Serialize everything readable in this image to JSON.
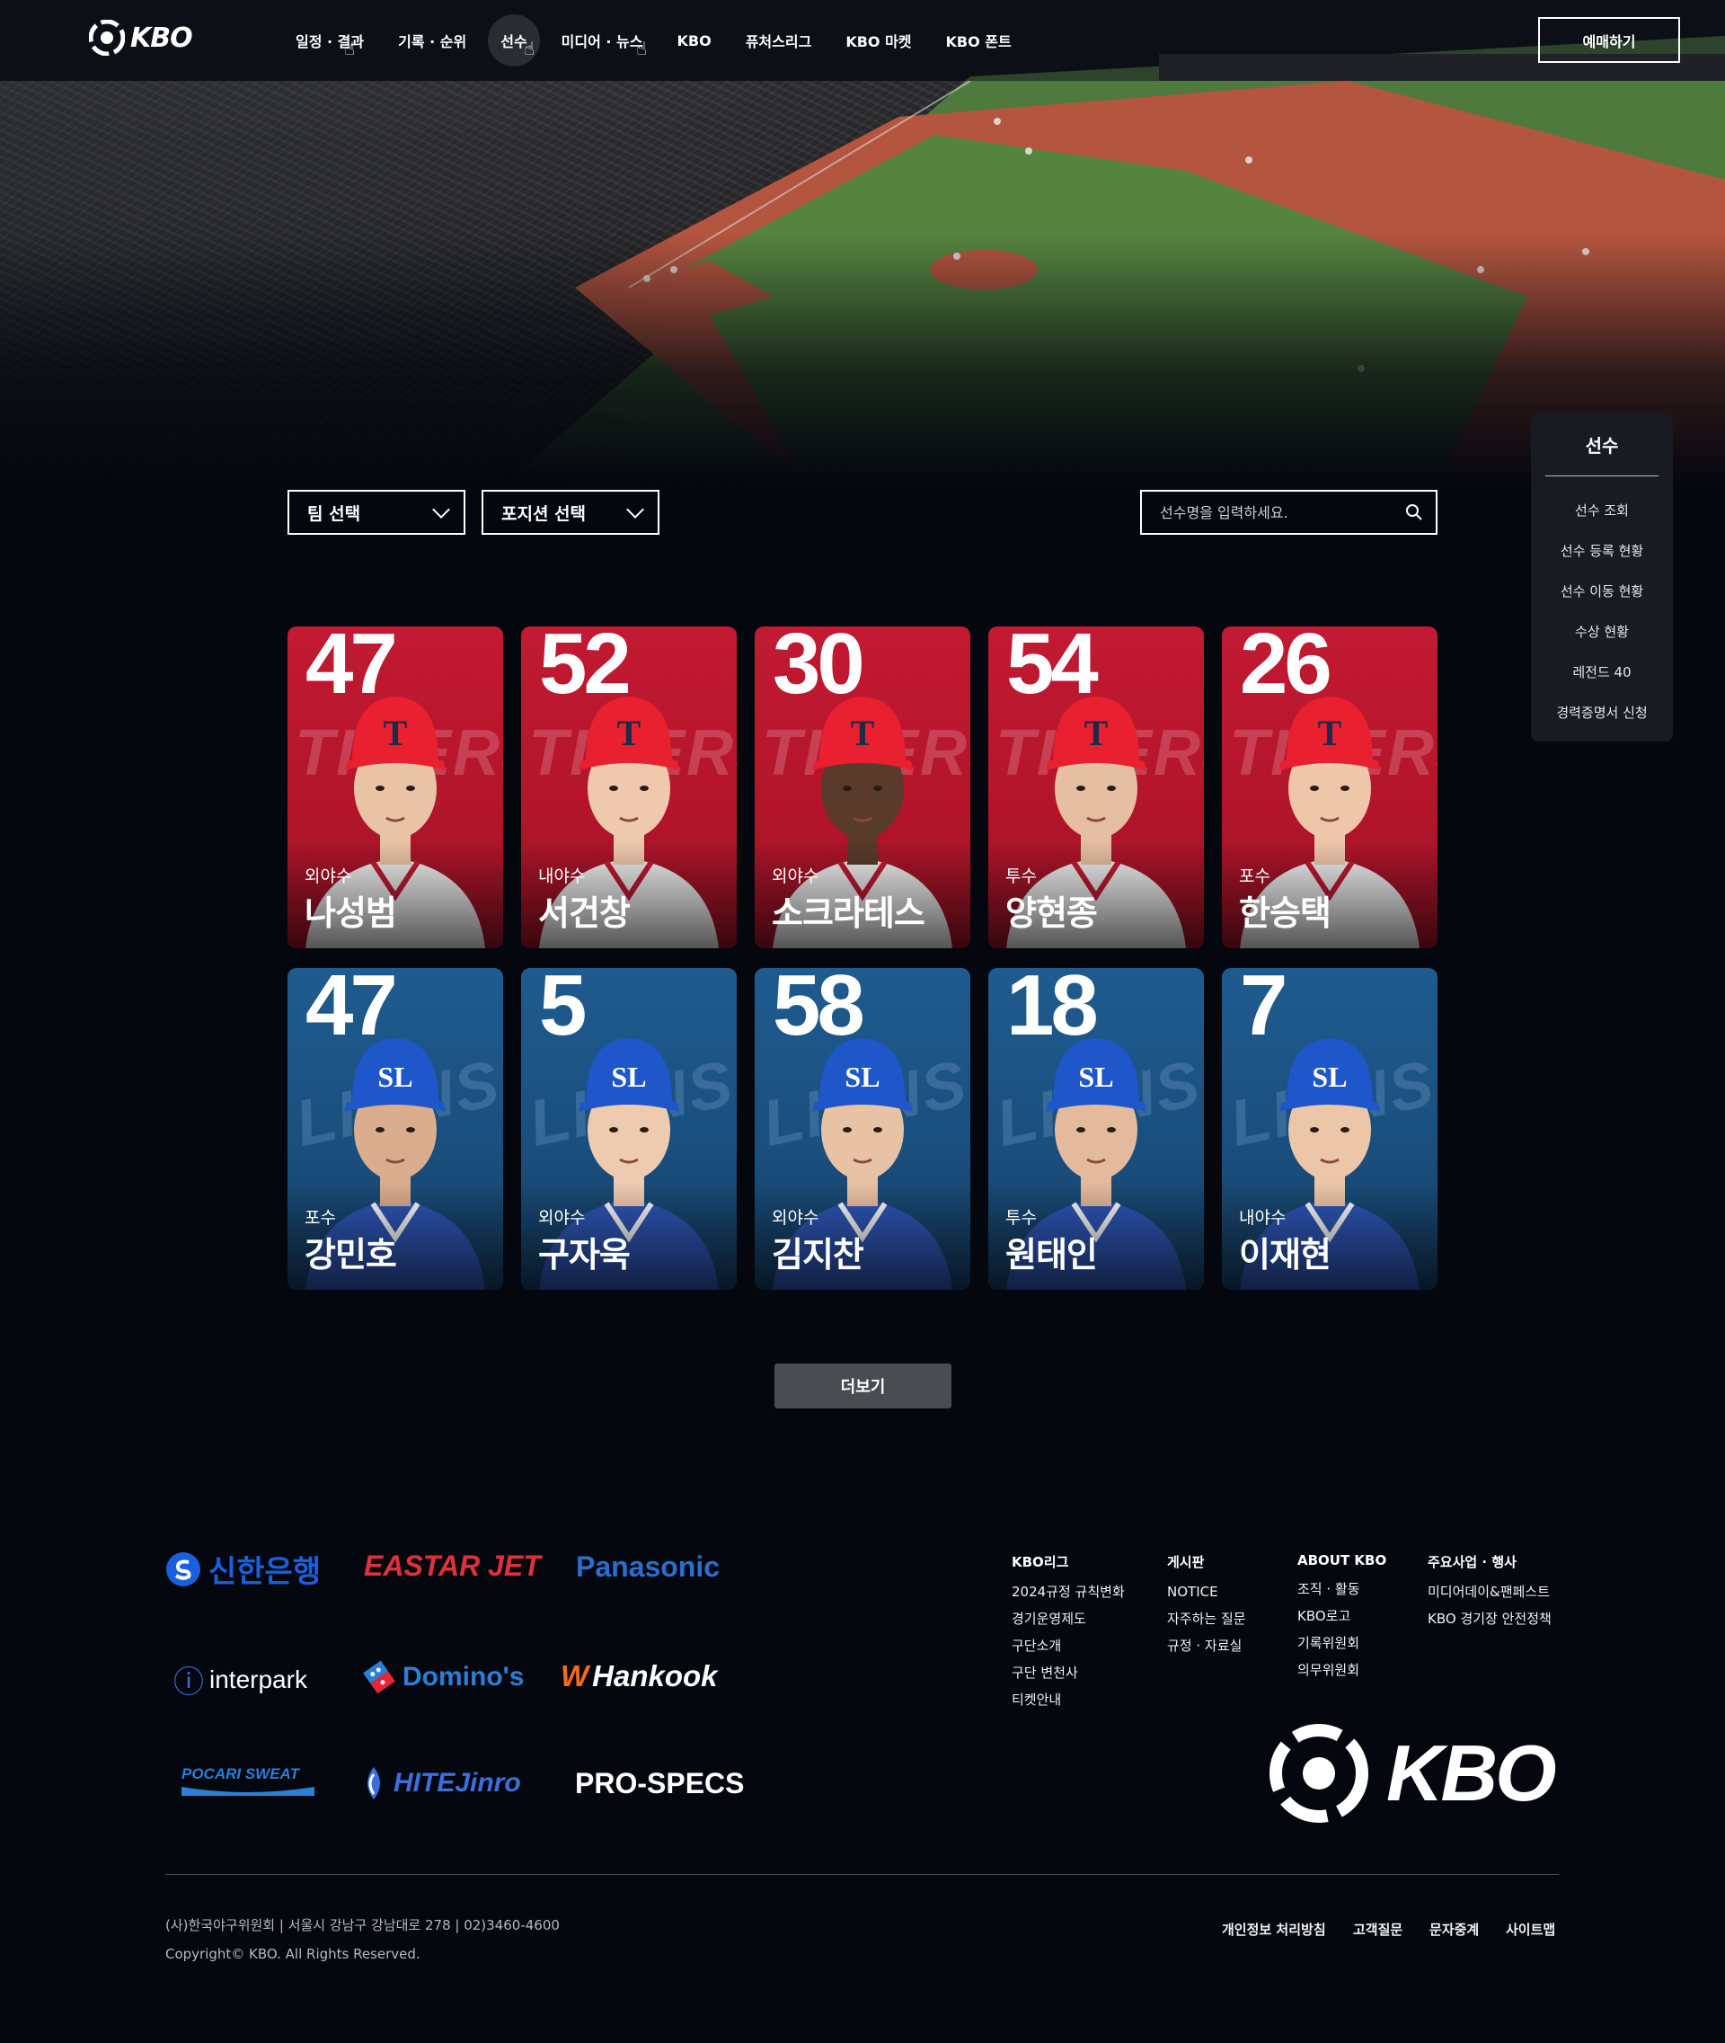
{
  "header": {
    "logo_text": "KBO",
    "menu": [
      "일정 · 결과",
      "기록 · 순위",
      "선수",
      "미디어 · 뉴스",
      "KBO",
      "퓨처스리그",
      "KBO 마켓",
      "KBO 폰트"
    ],
    "active_menu": "선수",
    "ticket_button": "예매하기"
  },
  "side_menu": {
    "title": "선수",
    "items": [
      "선수 조회",
      "선수 등록 현황",
      "선수 이동 현황",
      "수상 현황",
      "레전드 40",
      "경력증명서 신청"
    ]
  },
  "filters": {
    "team_select": "팀 선택",
    "position_select": "포지션 선택",
    "search_placeholder": "선수명을 입력하세요."
  },
  "players": [
    {
      "number": "47",
      "position": "외야수",
      "name": "나성범",
      "team": "red",
      "team_word": "TIGERS",
      "cap_logo": "T"
    },
    {
      "number": "52",
      "position": "내야수",
      "name": "서건창",
      "team": "red",
      "team_word": "TIGERS",
      "cap_logo": "T"
    },
    {
      "number": "30",
      "position": "외야수",
      "name": "소크라테스",
      "team": "red",
      "team_word": "TIGERS",
      "cap_logo": "T"
    },
    {
      "number": "54",
      "position": "투수",
      "name": "양현종",
      "team": "red",
      "team_word": "TIGERS",
      "cap_logo": "T"
    },
    {
      "number": "26",
      "position": "포수",
      "name": "한승택",
      "team": "red",
      "team_word": "TIGERS",
      "cap_logo": "T"
    },
    {
      "number": "47",
      "position": "포수",
      "name": "강민호",
      "team": "blue",
      "team_word": "LIONS",
      "cap_logo": "SL"
    },
    {
      "number": "5",
      "position": "외야수",
      "name": "구자욱",
      "team": "blue",
      "team_word": "LIONS",
      "cap_logo": "SL"
    },
    {
      "number": "58",
      "position": "외야수",
      "name": "김지찬",
      "team": "blue",
      "team_word": "LIONS",
      "cap_logo": "SL"
    },
    {
      "number": "18",
      "position": "투수",
      "name": "원태인",
      "team": "blue",
      "team_word": "LIONS",
      "cap_logo": "SL"
    },
    {
      "number": "7",
      "position": "내야수",
      "name": "이재현",
      "team": "blue",
      "team_word": "LIONS",
      "cap_logo": "SL"
    }
  ],
  "more_button": "더보기",
  "sponsors": {
    "shinhan": "신한은행",
    "eastar": "EASTAR JET",
    "panasonic": "Panasonic",
    "interpark": "interpark",
    "dominos": "Domino's",
    "hankook": "Hankook",
    "pocari": "POCARI SWEAT",
    "hitejinro": "HITEJinro",
    "prospecs": "PRO-SPECS"
  },
  "footer_links": [
    {
      "heading": "KBO리그",
      "items": [
        "2024규정 규칙변화",
        "경기운영제도",
        "구단소개",
        "구단 변천사",
        "티켓안내"
      ]
    },
    {
      "heading": "게시판",
      "items": [
        "NOTICE",
        "자주하는 질문",
        "규정 · 자료실"
      ]
    },
    {
      "heading": "ABOUT KBO",
      "items": [
        "조직 · 활동",
        "KBO로고",
        "기록위원회",
        "의무위원회"
      ]
    },
    {
      "heading": "주요사업 · 행사",
      "items": [
        "미디어데이&팬페스트",
        "KBO 경기장 안전정책"
      ]
    }
  ],
  "footer": {
    "logo_text": "KBO",
    "address": "(사)한국야구위원회 | 서울시 강남구 강남대로 278 | 02)3460-4600",
    "copyright": "Copyright© KBO. All Rights Reserved.",
    "legal_links": [
      "개인정보 처리방침",
      "고객질문",
      "문자중계",
      "사이트맵"
    ]
  },
  "colors": {
    "background": "#04070e",
    "tigers_red": "#c21a33",
    "lions_blue": "#1f5b8f",
    "more_button": "#4a4c51",
    "side_panel": "#181b22"
  }
}
